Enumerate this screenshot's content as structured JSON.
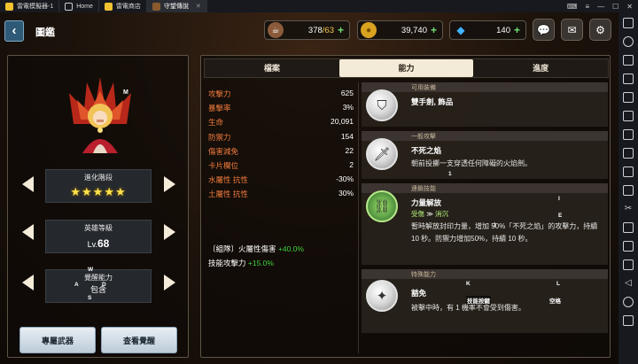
{
  "emulator": {
    "tabs": [
      {
        "label": "雷電模擬器-1"
      },
      {
        "label": "Home"
      },
      {
        "label": "雷電商店"
      },
      {
        "label": "守望傳說"
      }
    ]
  },
  "header": {
    "title": "圖鑑",
    "resources": [
      {
        "icon": "coffee-icon",
        "value": "378",
        "max": "/63"
      },
      {
        "icon": "gold-coin-icon",
        "value": "39,740"
      },
      {
        "icon": "gem-icon",
        "value": "140"
      }
    ]
  },
  "left": {
    "badge": "M",
    "evolution_label": "進化階段",
    "stars": "★★★★★",
    "hero_level_label": "英雄等級",
    "level_prefix": "Lv.",
    "level": "68",
    "awaken_label": "覺醒能力",
    "awaken_value": "包含",
    "exclusive_weapon_button": "專屬武器",
    "view_awaken_button": "查看覺醒"
  },
  "tabs": {
    "items": [
      "檔案",
      "能力",
      "進度"
    ],
    "active": 1
  },
  "stats": [
    {
      "k": "攻擊力",
      "v": "625"
    },
    {
      "k": "暴擊率",
      "v": "3%"
    },
    {
      "k": "生命",
      "v": "20,091"
    },
    {
      "k": "防禦力",
      "v": "154"
    },
    {
      "k": "傷害減免",
      "v": "22"
    },
    {
      "k": "卡片欄位",
      "v": "2"
    },
    {
      "k": "水屬性 抗性",
      "v": "-30%"
    },
    {
      "k": "土屬性 抗性",
      "v": "30%"
    }
  ],
  "bonuses": [
    {
      "label": "〔組隊〕火屬性傷害",
      "value": "+40.0%"
    },
    {
      "label": "技能攻擊力",
      "value": "+15.0%"
    }
  ],
  "skills": [
    {
      "header": "可用裝備",
      "name": "雙手劍, 飾品",
      "desc": ""
    },
    {
      "header": "一般攻擊",
      "name": "不死之焰",
      "desc": "朝前投擲一支穿透任何障礙的火焰劍。"
    },
    {
      "header": "連鎖技能",
      "name": "力量解放",
      "chain_from": "受傷",
      "chain_to": "消沉",
      "desc": "暫時解放封印力量，增加 50%「不死之焰」的攻擊力，持續 10 秒。防禦力增加50%，持續 10 秒。"
    },
    {
      "header": "特殊能力",
      "name": "豁免",
      "desc": "被擊中時，有 1 機率不會受到傷害。"
    }
  ],
  "keymap_hints": {
    "m": "M",
    "w": "W",
    "a": "A",
    "d": "D",
    "s": "S",
    "one": "1",
    "i": "I",
    "e": "E",
    "j": "J",
    "k": "K",
    "l": "L",
    "space": "空格",
    "skill_key": "技能按鍵"
  }
}
